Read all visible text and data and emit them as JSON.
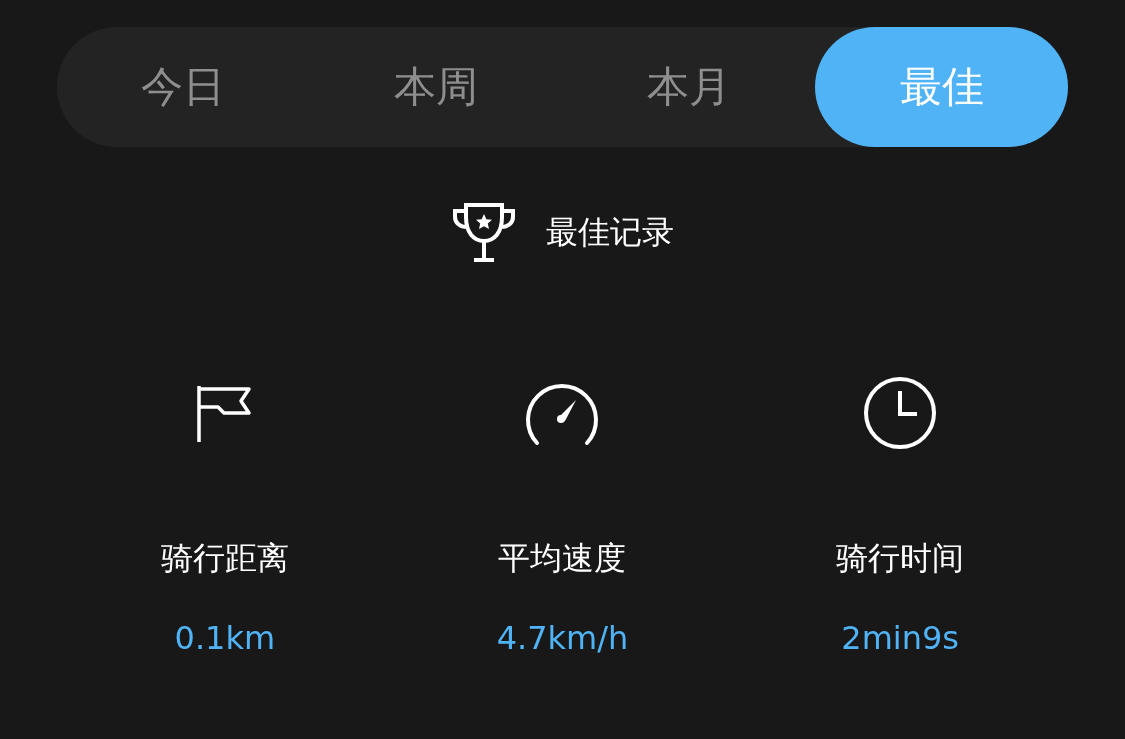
{
  "tabs": [
    {
      "label": "今日",
      "selected": false
    },
    {
      "label": "本周",
      "selected": false
    },
    {
      "label": "本月",
      "selected": false
    },
    {
      "label": "最佳",
      "selected": true
    }
  ],
  "header": {
    "title": "最佳记录"
  },
  "stats": [
    {
      "kind": "distance",
      "label": "骑行距离",
      "value": "0.1km"
    },
    {
      "kind": "speed",
      "label": "平均速度",
      "value": "4.7km/h"
    },
    {
      "kind": "time",
      "label": "骑行时间",
      "value": "2min9s"
    }
  ]
}
